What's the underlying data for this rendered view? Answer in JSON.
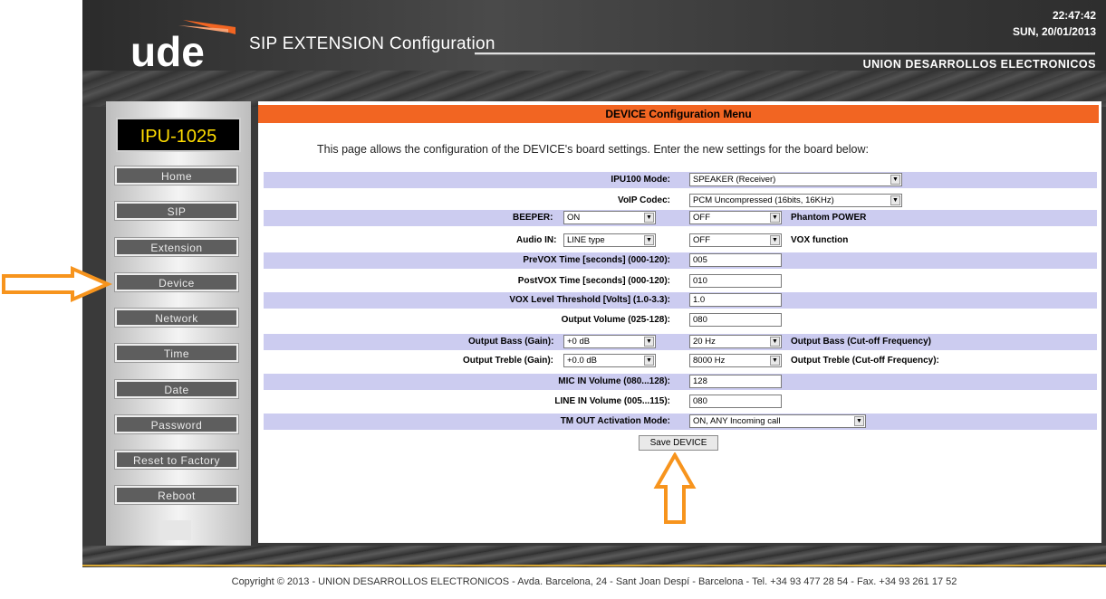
{
  "header": {
    "title": "SIP EXTENSION Configuration",
    "time": "22:47:42",
    "date": "SUN, 20/01/2013",
    "company": "UNION DESARROLLOS ELECTRONICOS"
  },
  "sidebar": {
    "device_id": "IPU-1025",
    "items": [
      {
        "label": "Home"
      },
      {
        "label": "SIP"
      },
      {
        "label": "Extension"
      },
      {
        "label": "Device"
      },
      {
        "label": "Network"
      },
      {
        "label": "Time"
      },
      {
        "label": "Date"
      },
      {
        "label": "Password"
      },
      {
        "label": "Reset to Factory"
      },
      {
        "label": "Reboot"
      }
    ]
  },
  "main": {
    "title": "DEVICE Configuration Menu",
    "intro": "This page allows the configuration of the DEVICE's board settings. Enter the new settings for the board below:",
    "fields": {
      "ipu100_mode": {
        "label": "IPU100 Mode:",
        "value": "SPEAKER (Receiver)"
      },
      "voip_codec": {
        "label": "VoIP Codec:",
        "value": "PCM Uncompressed (16bits, 16KHz)"
      },
      "beeper": {
        "label": "BEEPER:",
        "value": "ON"
      },
      "phantom_power": {
        "label": "Phantom POWER",
        "value": "OFF"
      },
      "audio_in": {
        "label": "Audio IN:",
        "value": "LINE type"
      },
      "vox_function": {
        "label": "VOX function",
        "value": "OFF"
      },
      "prevox_time": {
        "label": "PreVOX Time [seconds] (000-120):",
        "value": "005"
      },
      "postvox_time": {
        "label": "PostVOX Time [seconds] (000-120):",
        "value": "010"
      },
      "vox_threshold": {
        "label": "VOX Level Threshold [Volts] (1.0-3.3):",
        "value": "1.0"
      },
      "output_volume": {
        "label": "Output Volume (025-128):",
        "value": "080"
      },
      "output_bass_gain": {
        "label": "Output Bass (Gain):",
        "value": "+0 dB"
      },
      "output_bass_freq": {
        "label": "Output Bass (Cut-off Frequency)",
        "value": "20 Hz"
      },
      "output_treble_gain": {
        "label": "Output Treble (Gain):",
        "value": "+0.0 dB"
      },
      "output_treble_freq": {
        "label": "Output Treble (Cut-off Frequency):",
        "value": "8000 Hz"
      },
      "mic_in_volume": {
        "label": "MIC IN Volume (080...128):",
        "value": "128"
      },
      "line_in_volume": {
        "label": "LINE IN Volume (005...115):",
        "value": "080"
      },
      "tm_out_mode": {
        "label": "TM OUT Activation Mode:",
        "value": "ON, ANY Incoming call"
      }
    },
    "save_label": "Save DEVICE"
  },
  "footer": {
    "text": "Copyright © 2013 - UNION DESARROLLOS ELECTRONICOS  -  Avda. Barcelona, 24 - Sant Joan Despí  -  Barcelona  -  Tel. +34 93 477 28 54  -  Fax. +34 93 261 17 52"
  },
  "colors": {
    "accent": "#f26522",
    "row_shade": "#ccccf0",
    "annotation_arrow": "#f7941d",
    "device_id_text": "#ffdd00"
  }
}
